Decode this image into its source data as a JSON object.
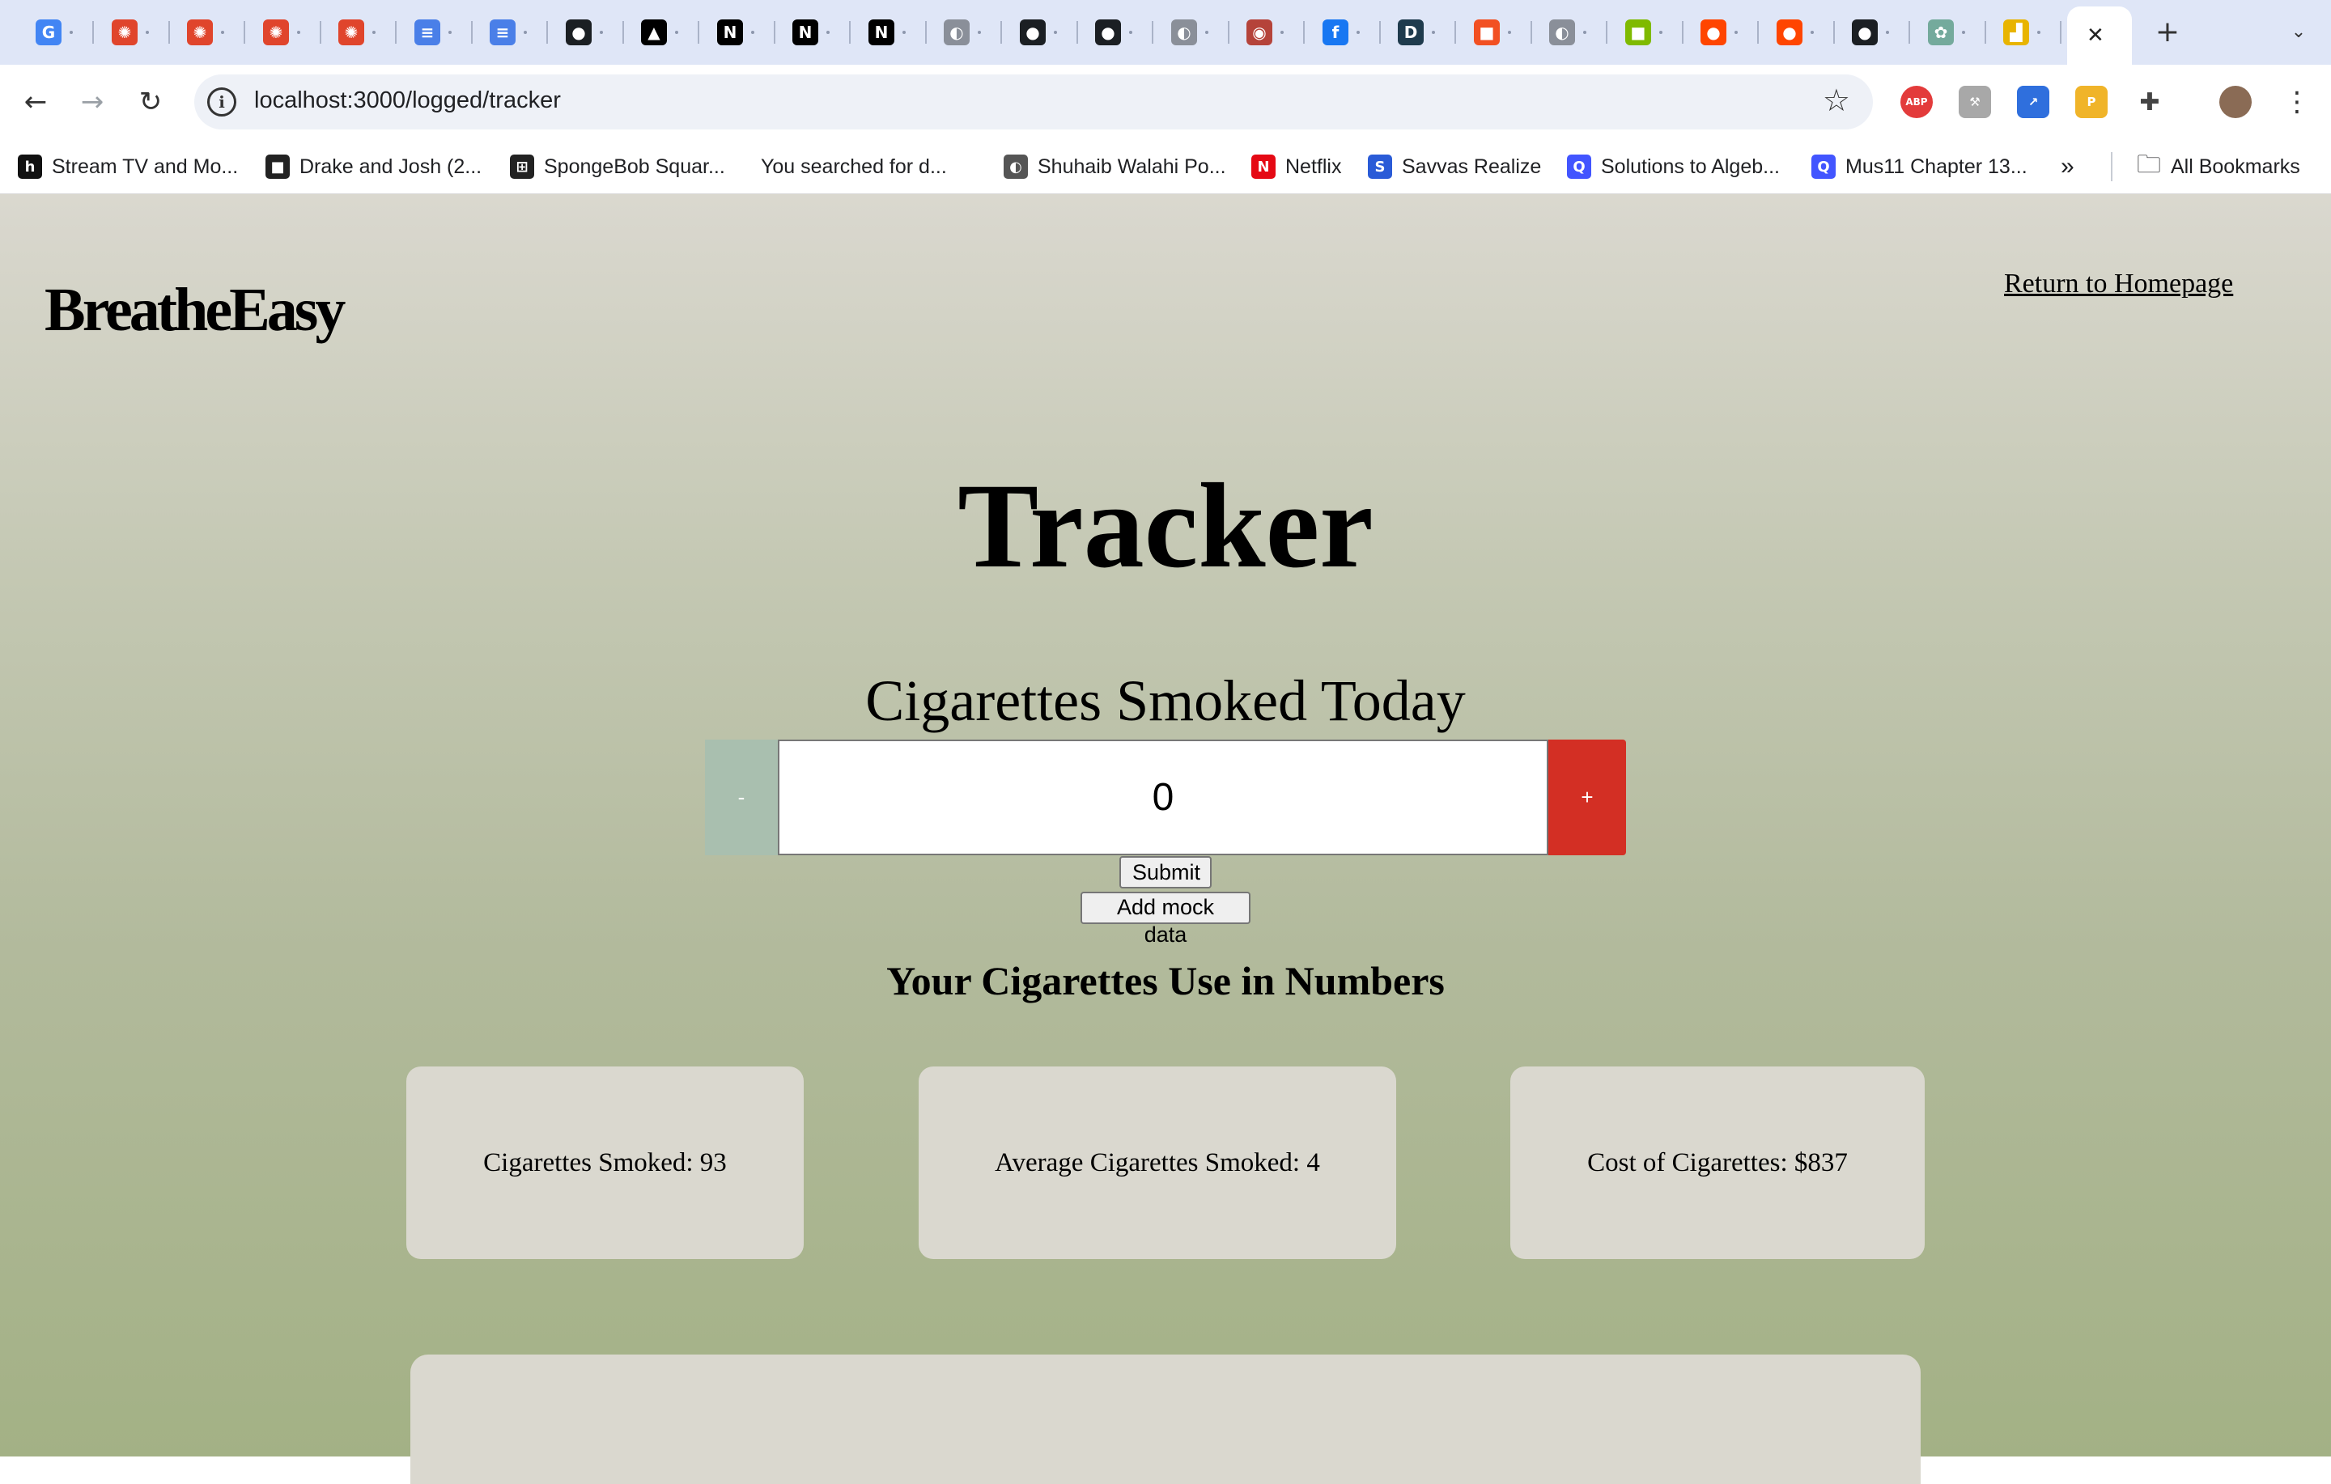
{
  "browser": {
    "tabs": [
      {
        "icon": "google-icon",
        "glyph": "G",
        "color": "#4285f4"
      },
      {
        "icon": "canvas-icon",
        "glyph": "✺",
        "color": "#e0452c"
      },
      {
        "icon": "canvas-icon",
        "glyph": "✺",
        "color": "#e0452c"
      },
      {
        "icon": "canvas-icon",
        "glyph": "✺",
        "color": "#e0452c"
      },
      {
        "icon": "canvas-icon",
        "glyph": "✺",
        "color": "#e0452c"
      },
      {
        "icon": "google-docs-icon",
        "glyph": "≡",
        "color": "#4a7fe8"
      },
      {
        "icon": "google-docs-icon",
        "glyph": "≡",
        "color": "#4a7fe8"
      },
      {
        "icon": "github-icon",
        "glyph": "●",
        "color": "#1b1f23"
      },
      {
        "icon": "vercel-icon",
        "glyph": "▲",
        "color": "#000000"
      },
      {
        "icon": "nextjs-icon",
        "glyph": "N",
        "color": "#000000"
      },
      {
        "icon": "nextjs-icon",
        "glyph": "N",
        "color": "#000000"
      },
      {
        "icon": "nextjs-icon",
        "glyph": "N",
        "color": "#000000"
      },
      {
        "icon": "globe-icon",
        "glyph": "◐",
        "color": "#8a8f99"
      },
      {
        "icon": "github-icon",
        "glyph": "●",
        "color": "#1b1f23"
      },
      {
        "icon": "github-icon",
        "glyph": "●",
        "color": "#1b1f23"
      },
      {
        "icon": "globe-icon",
        "glyph": "◐",
        "color": "#8a8f99"
      },
      {
        "icon": "mascot-icon",
        "glyph": "◉",
        "color": "#b5433a"
      },
      {
        "icon": "facebook-icon",
        "glyph": "f",
        "color": "#1877f2"
      },
      {
        "icon": "d-logo-icon",
        "glyph": "D",
        "color": "#1f3b4d"
      },
      {
        "icon": "microsoft-icon",
        "glyph": "■",
        "color": "#f25022"
      },
      {
        "icon": "globe-icon",
        "glyph": "◐",
        "color": "#8a8f99"
      },
      {
        "icon": "microsoft-icon",
        "glyph": "■",
        "color": "#7fba00"
      },
      {
        "icon": "reddit-icon",
        "glyph": "●",
        "color": "#ff4500"
      },
      {
        "icon": "reddit-icon",
        "glyph": "●",
        "color": "#ff4500"
      },
      {
        "icon": "github-icon",
        "glyph": "●",
        "color": "#1b1f23"
      },
      {
        "icon": "chatgpt-icon",
        "glyph": "✿",
        "color": "#74aa9c"
      },
      {
        "icon": "chart-icon",
        "glyph": "▟",
        "color": "#e8b400"
      }
    ],
    "active_tab_close": "✕",
    "new_tab": "+",
    "tab_search": "⌄",
    "back": "←",
    "forward": "→",
    "reload": "↻",
    "info": "i",
    "url": "localhost:3000/logged/tracker",
    "bookmark_star": "☆",
    "extensions": [
      {
        "icon": "adblock-plus-icon",
        "glyph": "ABP",
        "color": "#e33b3b"
      },
      {
        "icon": "hammer-icon",
        "glyph": "⚒",
        "color": "#a8a8a8"
      },
      {
        "icon": "open-link-icon",
        "glyph": "↗",
        "color": "#2f6fdd"
      },
      {
        "icon": "p-extension-icon",
        "glyph": "P",
        "color": "#f0b429"
      },
      {
        "icon": "puzzle-icon",
        "glyph": "✚",
        "color": "#444444"
      }
    ],
    "menu": "⋮",
    "bookmarks": [
      {
        "label": "Stream TV and Mo...",
        "icon": "hulu-icon",
        "glyph": "h",
        "color": "#111111"
      },
      {
        "label": "Drake and Josh (2...",
        "icon": "camera-icon",
        "glyph": "■",
        "color": "#222222"
      },
      {
        "label": "SpongeBob Squar...",
        "icon": "gift-icon",
        "glyph": "⊞",
        "color": "#222222"
      },
      {
        "label": "You searched for d...",
        "icon": "",
        "glyph": "",
        "color": "#ffffff"
      },
      {
        "label": "Shuhaib Walahi Po...",
        "icon": "globe-icon",
        "glyph": "◐",
        "color": "#555555"
      },
      {
        "label": "Netflix",
        "icon": "netflix-icon",
        "glyph": "N",
        "color": "#e50914"
      },
      {
        "label": "Savvas Realize",
        "icon": "savvas-icon",
        "glyph": "S",
        "color": "#2a5bd7"
      },
      {
        "label": "Solutions to Algeb...",
        "icon": "quizlet-icon",
        "glyph": "Q",
        "color": "#4255ff"
      },
      {
        "label": "Mus11 Chapter 13...",
        "icon": "quizlet-icon",
        "glyph": "Q",
        "color": "#4255ff"
      }
    ],
    "bookmarks_overflow": "»",
    "all_bookmarks": "All Bookmarks"
  },
  "page": {
    "logo": "BreatheEasy",
    "return_link": "Return to Homepage",
    "title": "Tracker",
    "subtitle": "Cigarettes Smoked Today",
    "stepper": {
      "minus": "-",
      "value": "0",
      "plus": "+",
      "minus_color": "#a9bfaf",
      "plus_color": "#d32f24"
    },
    "submit": "Submit",
    "mock": "Add mock data",
    "stats_heading": "Your Cigarettes Use in Numbers",
    "cards": {
      "smoked": "Cigarettes Smoked: 93",
      "average": "Average Cigarettes Smoked: 4",
      "cost": "Cost of Cigarettes: $837"
    }
  }
}
